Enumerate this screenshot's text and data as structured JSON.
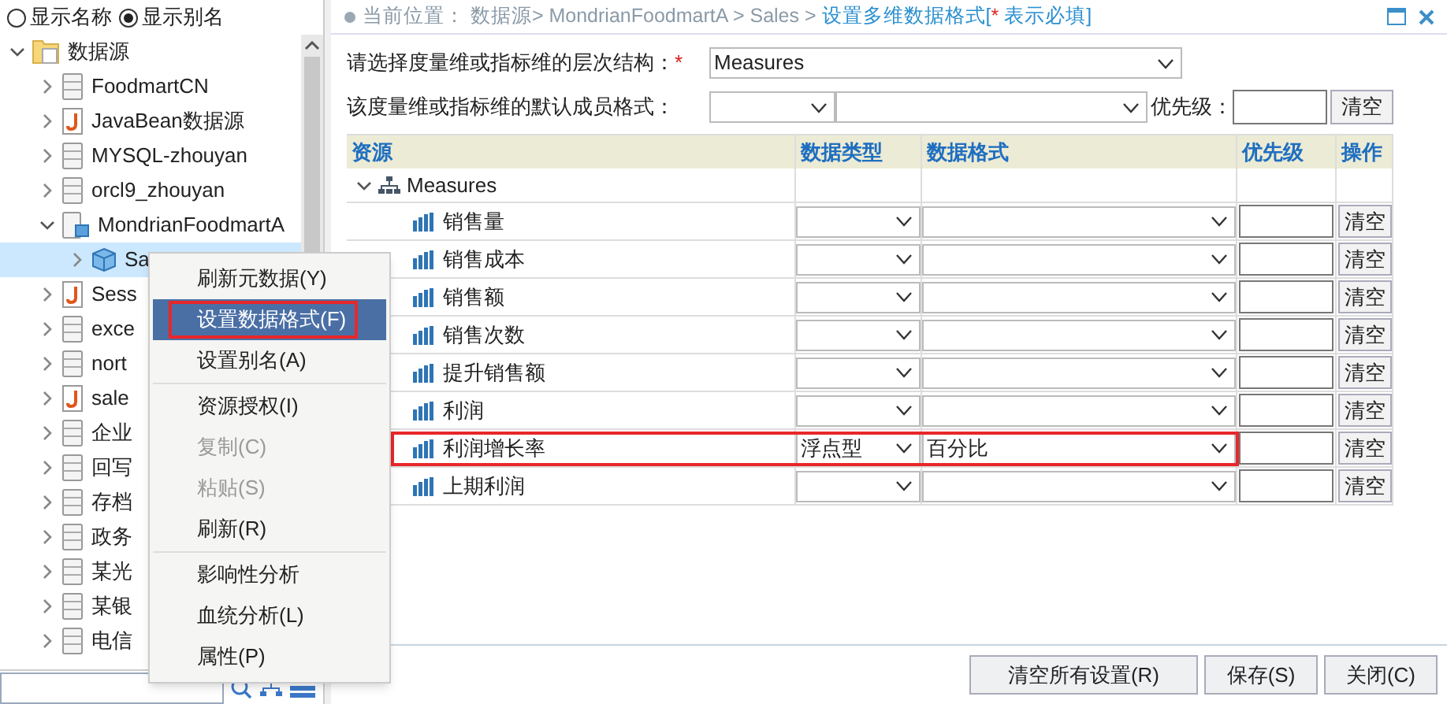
{
  "view_options": [
    {
      "label": "显示名称",
      "selected": false
    },
    {
      "label": "显示别名",
      "selected": true
    }
  ],
  "tree": [
    {
      "label": "数据源",
      "kind": "folder",
      "expanded": true,
      "children": [
        {
          "label": "FoodmartCN",
          "kind": "db",
          "expanded": false
        },
        {
          "label": "JavaBean数据源",
          "kind": "java",
          "expanded": false
        },
        {
          "label": "MYSQL-zhouyan",
          "kind": "db",
          "expanded": false
        },
        {
          "label": "orcl9_zhouyan",
          "kind": "db",
          "expanded": false
        },
        {
          "label": "MondrianFoodmartA",
          "kind": "olap",
          "expanded": true,
          "children": [
            {
              "label": "Sa",
              "kind": "cube",
              "expanded": false,
              "selected": true
            }
          ]
        },
        {
          "label": "Sess",
          "kind": "java",
          "expanded": false
        },
        {
          "label": "exce",
          "kind": "db",
          "expanded": false
        },
        {
          "label": "nort",
          "kind": "db",
          "expanded": false
        },
        {
          "label": "sale",
          "kind": "java",
          "expanded": false
        },
        {
          "label": "企业",
          "kind": "db",
          "expanded": false
        },
        {
          "label": "回写",
          "kind": "db",
          "expanded": false
        },
        {
          "label": "存档",
          "kind": "db",
          "expanded": false
        },
        {
          "label": "政务",
          "kind": "db",
          "expanded": false
        },
        {
          "label": "某光",
          "kind": "db",
          "expanded": false
        },
        {
          "label": "某银",
          "kind": "db",
          "expanded": false
        },
        {
          "label": "电信",
          "kind": "db",
          "expanded": false
        }
      ]
    }
  ],
  "context_menu": [
    [
      {
        "label": "刷新元数据(Y)",
        "selected": false,
        "disabled": false,
        "annotated": false
      },
      {
        "label": "设置数据格式(F)",
        "selected": true,
        "disabled": false,
        "annotated": true
      },
      {
        "label": "设置别名(A)",
        "selected": false,
        "disabled": false,
        "annotated": false
      }
    ],
    [
      {
        "label": "资源授权(I)",
        "selected": false,
        "disabled": false,
        "annotated": false
      },
      {
        "label": "复制(C)",
        "selected": false,
        "disabled": true,
        "annotated": false
      },
      {
        "label": "粘贴(S)",
        "selected": false,
        "disabled": true,
        "annotated": false
      },
      {
        "label": "刷新(R)",
        "selected": false,
        "disabled": false,
        "annotated": false
      }
    ],
    [
      {
        "label": "影响性分析",
        "selected": false,
        "disabled": false,
        "annotated": false
      },
      {
        "label": "血统分析(L)",
        "selected": false,
        "disabled": false,
        "annotated": false
      },
      {
        "label": "属性(P)",
        "selected": false,
        "disabled": false,
        "annotated": false
      }
    ]
  ],
  "breadcrumb": {
    "label": "当前位置：",
    "path": "数据源> MondrianFoodmartA > Sales >",
    "current": "设置多维数据格式[",
    "required_mark": "*",
    "required_note": "表示必填]"
  },
  "form": {
    "hierarchy_label": "请选择度量维或指标维的层次结构：",
    "hierarchy_required": "*",
    "hierarchy_value": "Measures",
    "default_format_label": "该度量维或指标维的默认成员格式：",
    "priority_label": "优先级：",
    "clear_button": "清空"
  },
  "table": {
    "columns": [
      "资源",
      "数据类型",
      "数据格式",
      "优先级",
      "操作"
    ],
    "root": {
      "label": "Measures",
      "expanded": true
    },
    "rows": [
      {
        "label": "销售量",
        "data_type": "",
        "data_format": "",
        "action": "清空",
        "annotated": false
      },
      {
        "label": "销售成本",
        "data_type": "",
        "data_format": "",
        "action": "清空",
        "annotated": false
      },
      {
        "label": "销售额",
        "data_type": "",
        "data_format": "",
        "action": "清空",
        "annotated": false
      },
      {
        "label": "销售次数",
        "data_type": "",
        "data_format": "",
        "action": "清空",
        "annotated": false
      },
      {
        "label": "提升销售额",
        "data_type": "",
        "data_format": "",
        "action": "清空",
        "annotated": false
      },
      {
        "label": "利润",
        "data_type": "",
        "data_format": "",
        "action": "清空",
        "annotated": false
      },
      {
        "label": "利润增长率",
        "data_type": "浮点型",
        "data_format": "百分比",
        "action": "清空",
        "annotated": true
      },
      {
        "label": "上期利润",
        "data_type": "",
        "data_format": "",
        "action": "清空",
        "annotated": false
      }
    ]
  },
  "footer_buttons": [
    "清空所有设置(R)",
    "保存(S)",
    "关闭(C)"
  ]
}
